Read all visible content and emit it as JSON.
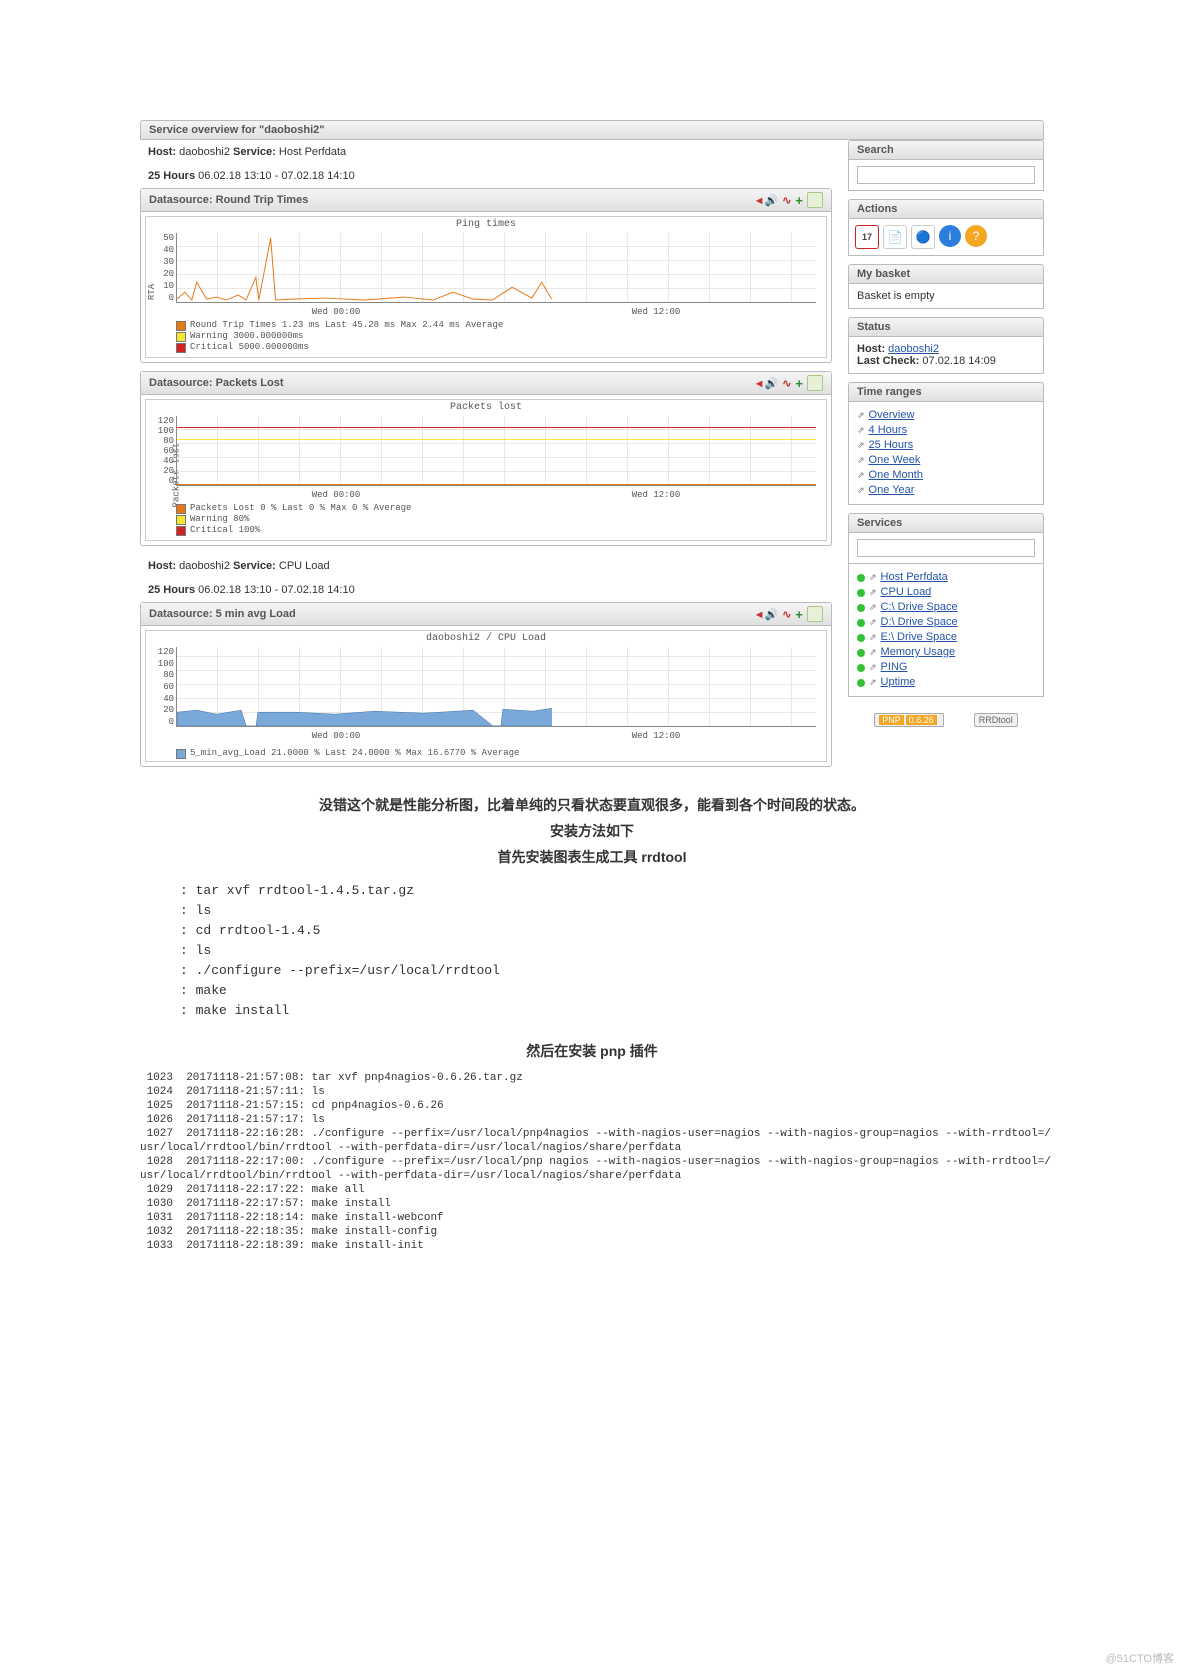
{
  "header": {
    "title": "Service overview for \"daoboshi2\""
  },
  "service1": {
    "host_label": "Host:",
    "host": "daoboshi2",
    "service_label": "Service:",
    "service": "Host Perfdata",
    "range_bold": "25 Hours",
    "range": "06.02.18 13:10 - 07.02.18 14:10"
  },
  "graph1": {
    "title": "Datasource: Round Trip Times",
    "plot_title": "Ping times",
    "legend1": "Round Trip Times   1.23 ms Last   45.28 ms Max   2.44 ms Average",
    "legend2": "Warning  3000.000000ms",
    "legend3": "Critical 5000.000000ms",
    "x1": "Wed 00:00",
    "x2": "Wed 12:00",
    "yticks": [
      "0",
      "10",
      "20",
      "30",
      "40",
      "50"
    ],
    "ylabel": "RTA"
  },
  "graph2": {
    "title": "Datasource: Packets Lost",
    "plot_title": "Packets lost",
    "legend1": "Packets Lost   0 % Last   0 % Max   0 % Average",
    "legend2": "Warning  80%",
    "legend3": "Critical 100%",
    "x1": "Wed 00:00",
    "x2": "Wed 12:00",
    "yticks": [
      "0",
      "20",
      "40",
      "60",
      "80",
      "100",
      "120"
    ],
    "ylabel": "Packets lost"
  },
  "service2": {
    "host_label": "Host:",
    "host": "daoboshi2",
    "service_label": "Service:",
    "service": "CPU Load",
    "range_bold": "25 Hours",
    "range": "06.02.18 13:10 - 07.02.18 14:10"
  },
  "graph3": {
    "title": "Datasource: 5 min avg Load",
    "plot_title": "daoboshi2 / CPU Load",
    "legend1": "5_min_avg_Load   21.0000  % Last   24.0000  % Max   16.6770  % Average",
    "x1": "Wed 00:00",
    "x2": "Wed 12:00",
    "yticks": [
      "0",
      "20",
      "40",
      "60",
      "80",
      "100",
      "120"
    ]
  },
  "sidebar": {
    "search_title": "Search",
    "actions_title": "Actions",
    "basket_title": "My basket",
    "basket_text": "Basket is empty",
    "status_title": "Status",
    "status_host_label": "Host:",
    "status_host": "daoboshi2",
    "status_check_label": "Last Check:",
    "status_check": "07.02.18 14:09",
    "timeranges_title": "Time ranges",
    "timeranges": [
      "Overview",
      "4 Hours",
      "25 Hours",
      "One Week",
      "One Month",
      "One Year"
    ],
    "services_title": "Services",
    "services": [
      "Host Perfdata",
      "CPU Load",
      "C:\\ Drive Space",
      "D:\\ Drive Space",
      "E:\\ Drive Space",
      "Memory Usage",
      "PING",
      "Uptime"
    ],
    "badge_pnp_label": "PNP",
    "badge_pnp_ver": "0.6.26",
    "badge_rrd": "RRDtool"
  },
  "article": {
    "line1": "没错这个就是性能分析图，比着单纯的只看状态要直观很多，能看到各个时间段的状态。",
    "line2": "安装方法如下",
    "line3": "首先安装图表生成工具 rrdtool",
    "code_lines": [
      ": tar xvf rrdtool-1.4.5.tar.gz",
      ": ls",
      ": cd rrdtool-1.4.5",
      ": ls",
      ": ./configure --prefix=/usr/local/rrdtool",
      ": make",
      ": make install"
    ],
    "line4": "然后在安装 pnp 插件",
    "terminal": " 1023  20171118-21:57:08: tar xvf pnp4nagios-0.6.26.tar.gz\n 1024  20171118-21:57:11: ls\n 1025  20171118-21:57:15: cd pnp4nagios-0.6.26\n 1026  20171118-21:57:17: ls\n 1027  20171118-22:16:28: ./configure --perfix=/usr/local/pnp4nagios --with-nagios-user=nagios --with-nagios-group=nagios --with-rrdtool=/\nusr/local/rrdtool/bin/rrdtool --with-perfdata-dir=/usr/local/nagios/share/perfdata\n 1028  20171118-22:17:00: ./configure --prefix=/usr/local/pnp nagios --with-nagios-user=nagios --with-nagios-group=nagios --with-rrdtool=/\nusr/local/rrdtool/bin/rrdtool --with-perfdata-dir=/usr/local/nagios/share/perfdata\n 1029  20171118-22:17:22: make all\n 1030  20171118-22:17:57: make install\n 1031  20171118-22:18:14: make install-webconf\n 1032  20171118-22:18:35: make install-config\n 1033  20171118-22:18:39: make install-init"
  },
  "watermark": "@51CTO博客",
  "chart_data": [
    {
      "type": "line",
      "title": "Ping times",
      "ylabel": "RTA",
      "ylim": [
        0,
        50
      ],
      "x_ticks": [
        "Wed 00:00",
        "Wed 12:00"
      ],
      "series": [
        {
          "name": "Round Trip Times",
          "stats": {
            "last": 1.23,
            "max": 45.28,
            "average": 2.44,
            "unit": "ms"
          }
        }
      ],
      "thresholds": {
        "warning": 3000,
        "critical": 5000,
        "unit": "ms"
      }
    },
    {
      "type": "line",
      "title": "Packets lost",
      "ylabel": "Packets lost",
      "ylim": [
        0,
        120
      ],
      "x_ticks": [
        "Wed 00:00",
        "Wed 12:00"
      ],
      "series": [
        {
          "name": "Packets Lost",
          "stats": {
            "last": 0,
            "max": 0,
            "average": 0,
            "unit": "%"
          }
        }
      ],
      "thresholds": {
        "warning": 80,
        "critical": 100,
        "unit": "%"
      }
    },
    {
      "type": "area",
      "title": "daoboshi2 / CPU Load",
      "ylim": [
        0,
        120
      ],
      "x_ticks": [
        "Wed 00:00",
        "Wed 12:00"
      ],
      "series": [
        {
          "name": "5_min_avg_Load",
          "stats": {
            "last": 21.0,
            "max": 24.0,
            "average": 16.677,
            "unit": "%"
          }
        }
      ]
    }
  ]
}
